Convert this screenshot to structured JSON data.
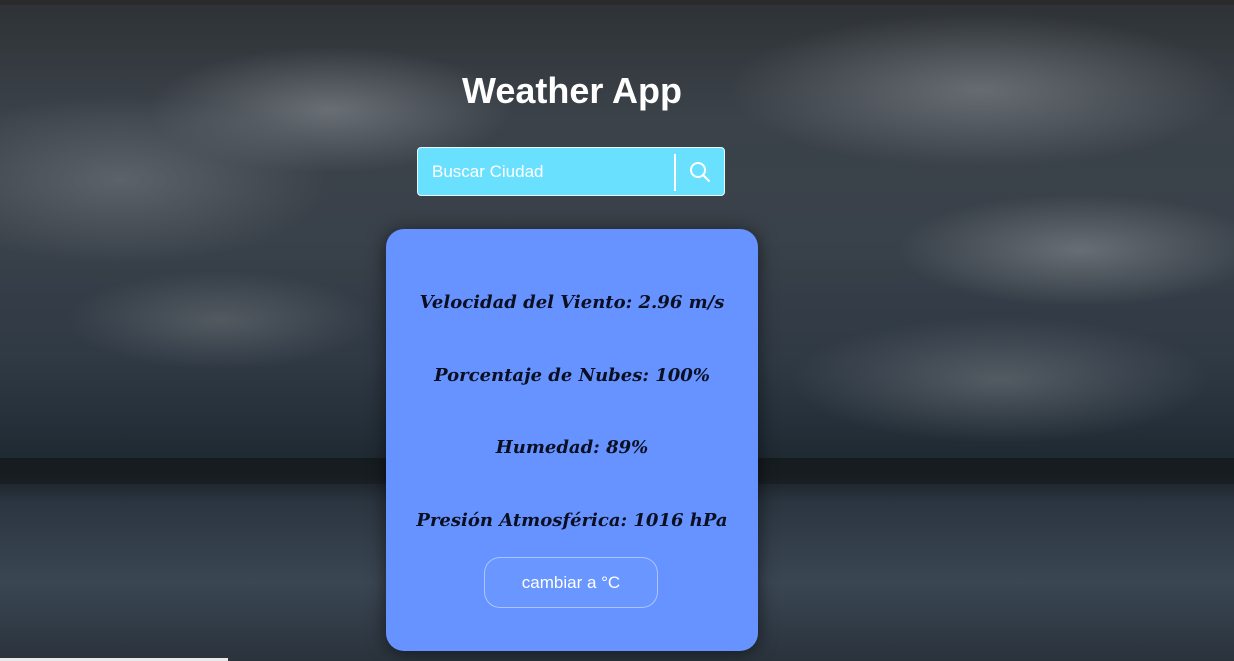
{
  "app": {
    "title": "Weather App"
  },
  "search": {
    "placeholder": "Buscar Ciudad",
    "value": "",
    "icon": "search-icon"
  },
  "weather": {
    "wind": "Velocidad del Viento: 2.96 m/s",
    "clouds": "Porcentaje de Nubes: 100%",
    "humidity": "Humedad: 89%",
    "pressure": "Presión Atmosférica: 1016 hPa"
  },
  "units": {
    "toggle_label": "cambiar a °C"
  },
  "colors": {
    "search_bg": "#6ae0ff",
    "card_bg": "#6693ff",
    "title": "#ffffff"
  }
}
